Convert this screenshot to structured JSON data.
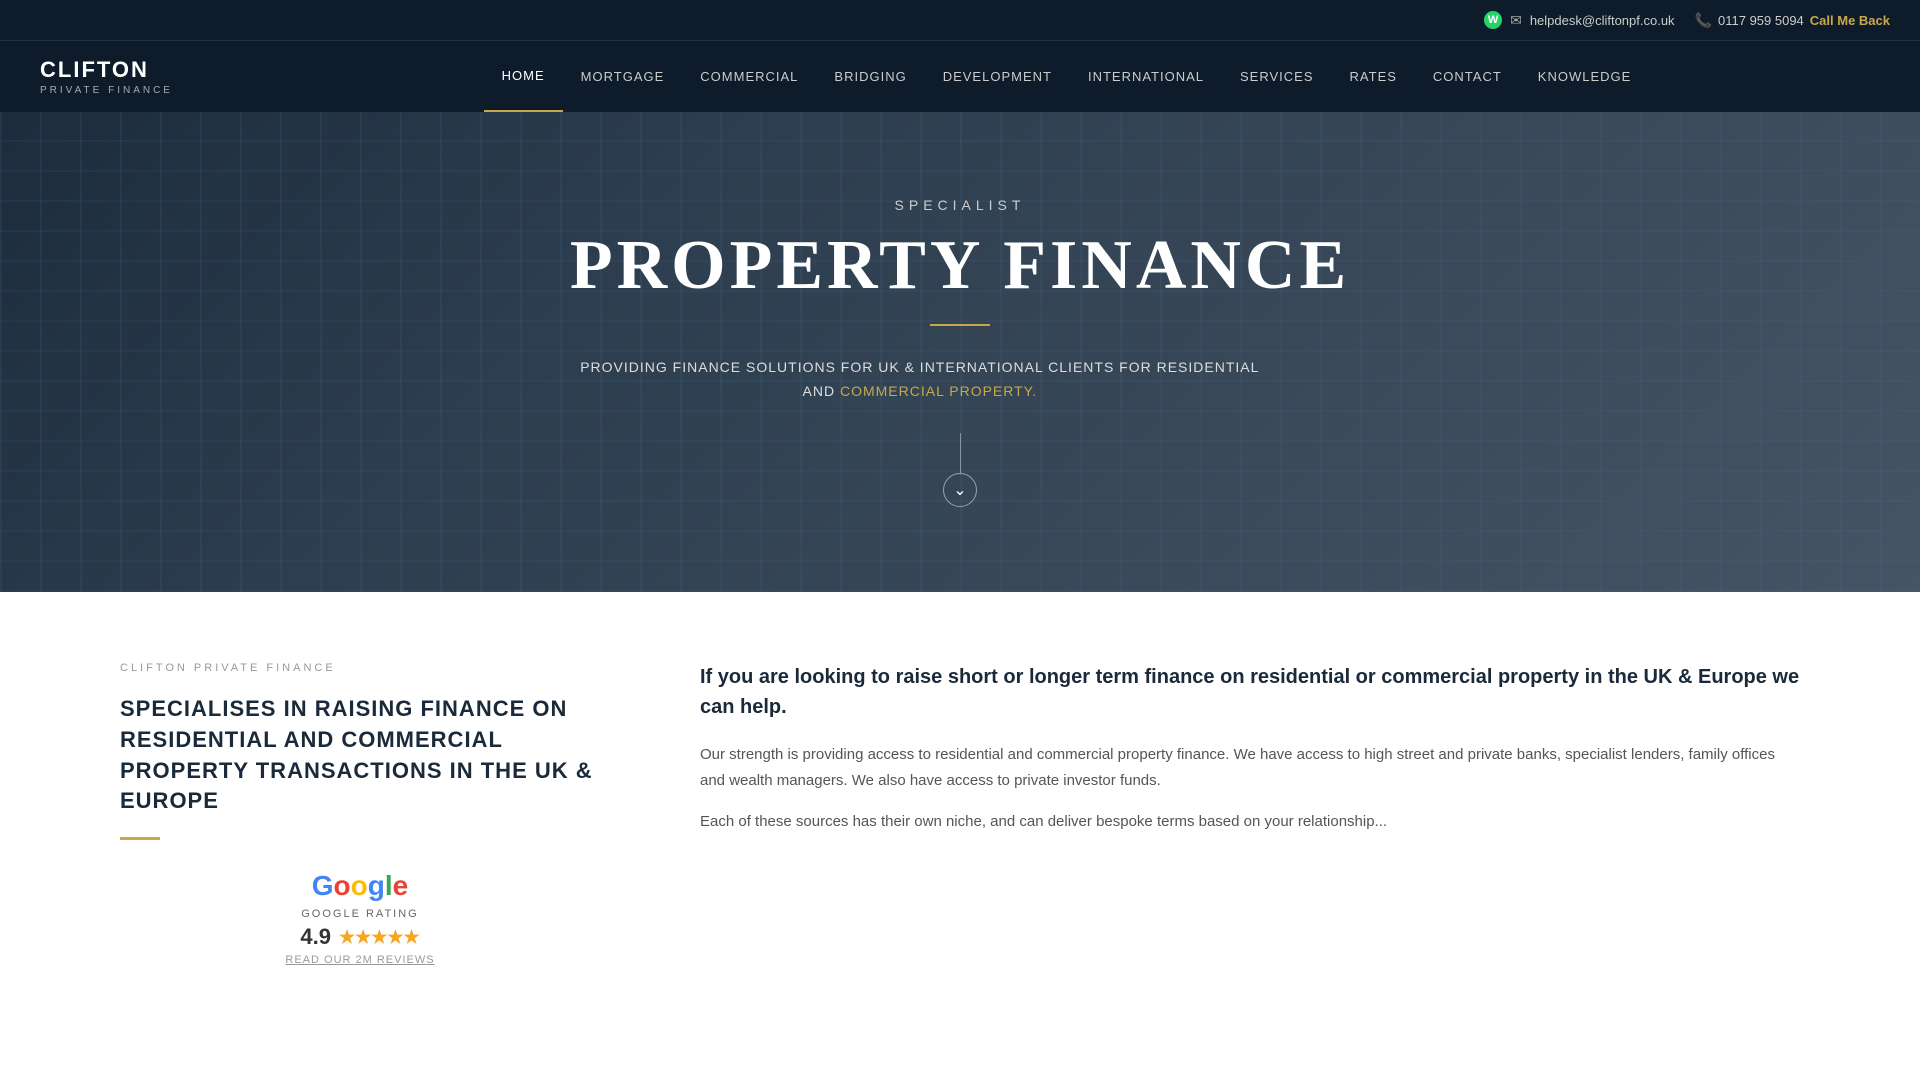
{
  "topbar": {
    "whatsapp_icon": "W",
    "email_icon": "✉",
    "email": "helpdesk@cliftonpf.co.uk",
    "phone_icon": "📞",
    "phone": "0117 959 5094",
    "call_me_back": "Call Me Back"
  },
  "navbar": {
    "logo_name": "CLIFTON",
    "logo_sub": "PRIVATE FINANCE",
    "links": [
      {
        "label": "HOME",
        "active": true
      },
      {
        "label": "MORTGAGE",
        "active": false
      },
      {
        "label": "COMMERCIAL",
        "active": false
      },
      {
        "label": "BRIDGING",
        "active": false
      },
      {
        "label": "DEVELOPMENT",
        "active": false
      },
      {
        "label": "INTERNATIONAL",
        "active": false
      },
      {
        "label": "SERVICES",
        "active": false
      },
      {
        "label": "RATES",
        "active": false
      },
      {
        "label": "CONTACT",
        "active": false
      },
      {
        "label": "KNOWLEDGE",
        "active": false
      }
    ]
  },
  "hero": {
    "specialist": "SPECIALIST",
    "title": "PROPERTY FINANCE",
    "subtitle_plain": "PROVIDING FINANCE SOLUTIONS FOR UK & INTERNATIONAL CLIENTS FOR RESIDENTIAL AND",
    "subtitle_highlight": "COMMERCIAL PROPERTY.",
    "scroll_arrow": "⌄"
  },
  "content_left": {
    "label": "CLIFTON PRIVATE FINANCE",
    "heading": "SPECIALISES IN RAISING FINANCE ON RESIDENTIAL AND COMMERCIAL PROPERTY TRANSACTIONS IN THE UK & EUROPE",
    "google_label": "GOOGLE RATING",
    "rating_score": "4.9",
    "stars": "★★★★★",
    "read_reviews": "READ OUR 2M REVIEWS"
  },
  "content_right": {
    "intro": "If you are looking to raise short or longer term finance on residential or commercial property in the UK & Europe we can help.",
    "para1": "Our strength is providing access to residential and commercial property finance. We have access to high street and private banks, specialist lenders, family offices and wealth managers. We also have access to private investor funds.",
    "para2": "Each of these sources has their own niche, and can deliver bespoke terms based on your relationship..."
  }
}
